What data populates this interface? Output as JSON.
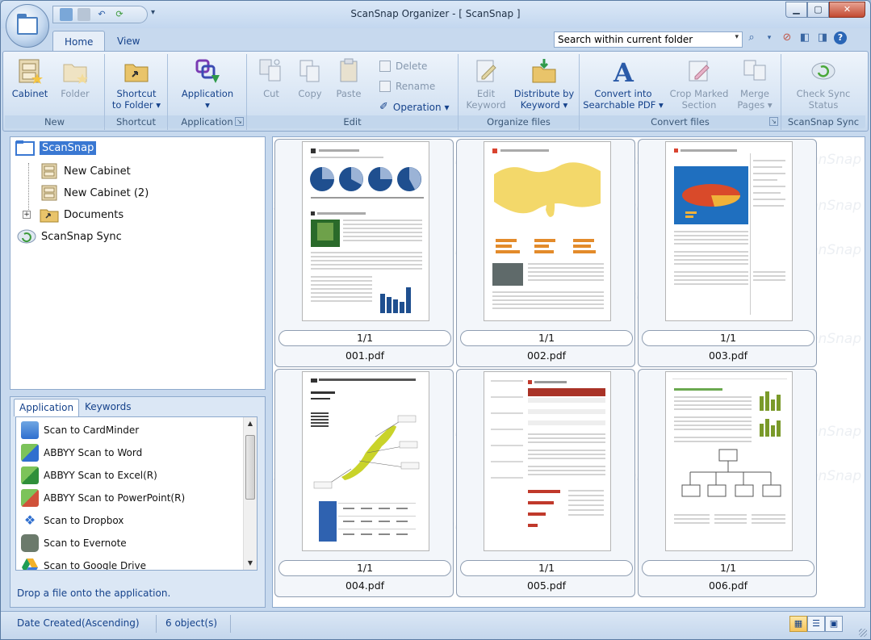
{
  "window": {
    "title": "ScanSnap Organizer - [ ScanSnap ]",
    "controls": {
      "minimize": "▭",
      "maximize": "▢",
      "close": "✕"
    }
  },
  "quick_access": {
    "icons": [
      "scan-icon",
      "print-icon",
      "undo-icon",
      "sync-icon"
    ],
    "dropdown": "▾"
  },
  "tabs": [
    {
      "label": "Home",
      "active": true
    },
    {
      "label": "View",
      "active": false
    }
  ],
  "search": {
    "value": "Search within current folder",
    "dropdown": "▾"
  },
  "ribbon": {
    "groups": {
      "new": "New",
      "shortcut": "Shortcut",
      "application": "Application",
      "edit": "Edit",
      "organize": "Organize files",
      "convert": "Convert files",
      "sync": "ScanSnap Sync"
    },
    "buttons": {
      "cabinet": "Cabinet",
      "folder": "Folder",
      "shortcut_line1": "Shortcut",
      "shortcut_line2": "to Folder ▾",
      "application": "Application",
      "application_arrow": "▾",
      "cut": "Cut",
      "copy": "Copy",
      "paste": "Paste",
      "delete": "Delete",
      "rename": "Rename",
      "operation": "Operation ▾",
      "edit_keyword_1": "Edit",
      "edit_keyword_2": "Keyword",
      "distribute_1": "Distribute by",
      "distribute_2": "Keyword ▾",
      "convert_1": "Convert into",
      "convert_2": "Searchable PDF ▾",
      "crop_1": "Crop Marked",
      "crop_2": "Section",
      "merge_1": "Merge",
      "merge_2": "Pages ▾",
      "sync_1": "Check Sync",
      "sync_2": "Status"
    }
  },
  "tree": {
    "items": [
      {
        "label": "ScanSnap",
        "selected": true
      },
      {
        "label": "New Cabinet"
      },
      {
        "label": "New Cabinet (2)"
      },
      {
        "label": "Documents",
        "expander": "+"
      },
      {
        "label": "ScanSnap Sync"
      }
    ]
  },
  "app_panel": {
    "tabs": [
      {
        "label": "Application",
        "active": true
      },
      {
        "label": "Keywords",
        "active": false
      }
    ],
    "items": [
      {
        "label": "Scan to CardMinder",
        "icon": "cardminder-icon",
        "color": "#3b7fd0"
      },
      {
        "label": "ABBYY Scan to Word",
        "icon": "abbyy-word-icon",
        "color": "#4a9a3a"
      },
      {
        "label": "ABBYY Scan to Excel(R)",
        "icon": "abbyy-excel-icon",
        "color": "#4a9a3a"
      },
      {
        "label": "ABBYY Scan to PowerPoint(R)",
        "icon": "abbyy-powerpoint-icon",
        "color": "#4a9a3a"
      },
      {
        "label": "Scan to Dropbox",
        "icon": "dropbox-icon",
        "color": "#2f6fcf"
      },
      {
        "label": "Scan to Evernote",
        "icon": "evernote-icon",
        "color": "#5f6f5f"
      },
      {
        "label": "Scan to Google Drive",
        "icon": "google-drive-icon",
        "color": "#f2b12a"
      }
    ],
    "hint": "Drop a file onto the application."
  },
  "files": [
    {
      "count": "1/1",
      "name": "001.pdf"
    },
    {
      "count": "1/1",
      "name": "002.pdf"
    },
    {
      "count": "1/1",
      "name": "003.pdf"
    },
    {
      "count": "1/1",
      "name": "004.pdf"
    },
    {
      "count": "1/1",
      "name": "005.pdf"
    },
    {
      "count": "1/1",
      "name": "006.pdf"
    }
  ],
  "watermark": "ScanSnap",
  "status": {
    "sort": "Date Created(Ascending)",
    "objects": "6 object(s)"
  },
  "colors": {
    "accent": "#15428b",
    "selection": "#3a78d2",
    "ribbon": "#dbe7f5"
  }
}
